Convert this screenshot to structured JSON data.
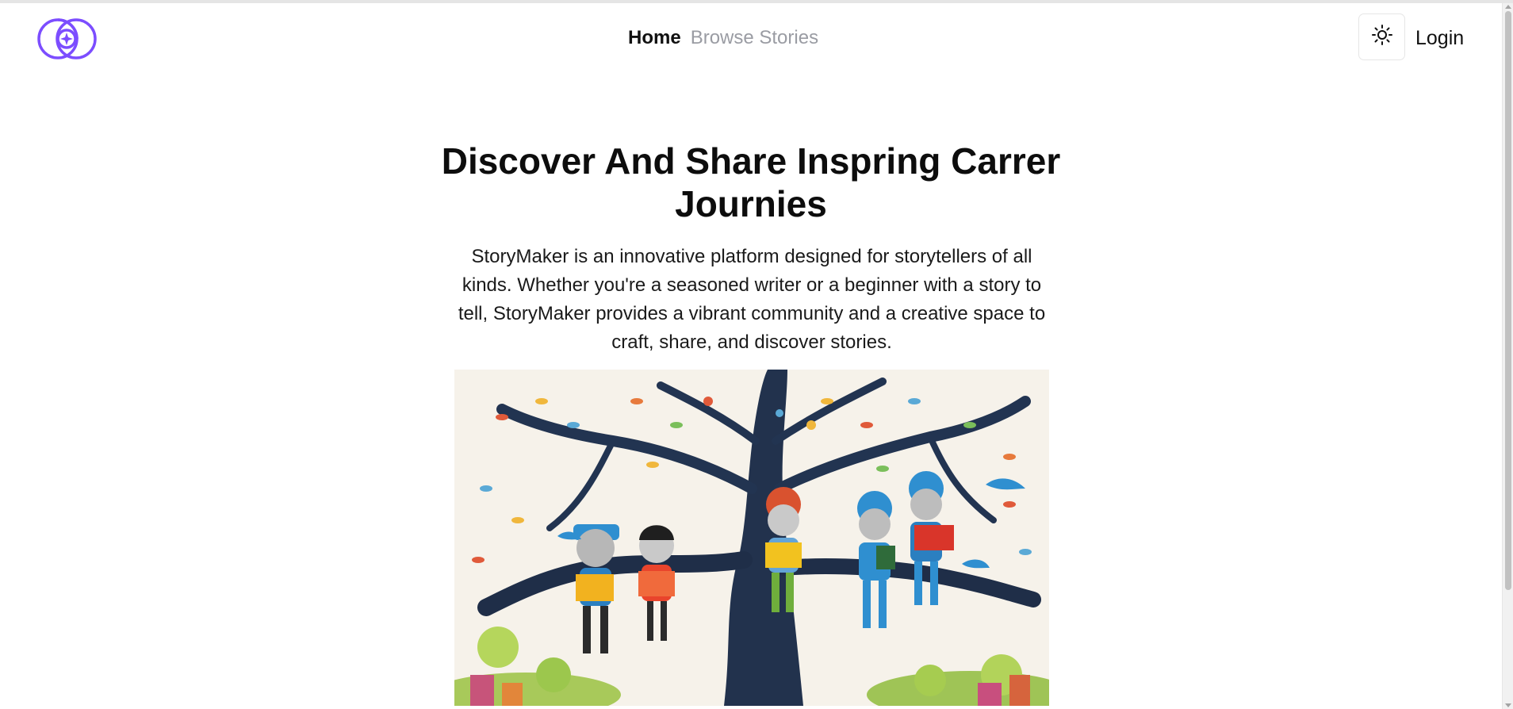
{
  "header": {
    "logo_icon": "brand-logo-icon",
    "nav": [
      {
        "label": "Home",
        "active": true
      },
      {
        "label": "Browse Stories",
        "active": false
      }
    ],
    "theme_toggle_icon": "sun-icon",
    "login_label": "Login"
  },
  "hero": {
    "title": "Discover And Share Inspring Carrer Journies",
    "description": "StoryMaker is an innovative platform designed for storytellers of all kinds. Whether you're a seasoned writer or a beginner with a story to tell, StoryMaker provides a vibrant community and a creative space to craft, share, and discover stories."
  },
  "colors": {
    "brand": "#7c4dff",
    "nav_inactive": "#9a9ca3",
    "text": "#111111"
  }
}
